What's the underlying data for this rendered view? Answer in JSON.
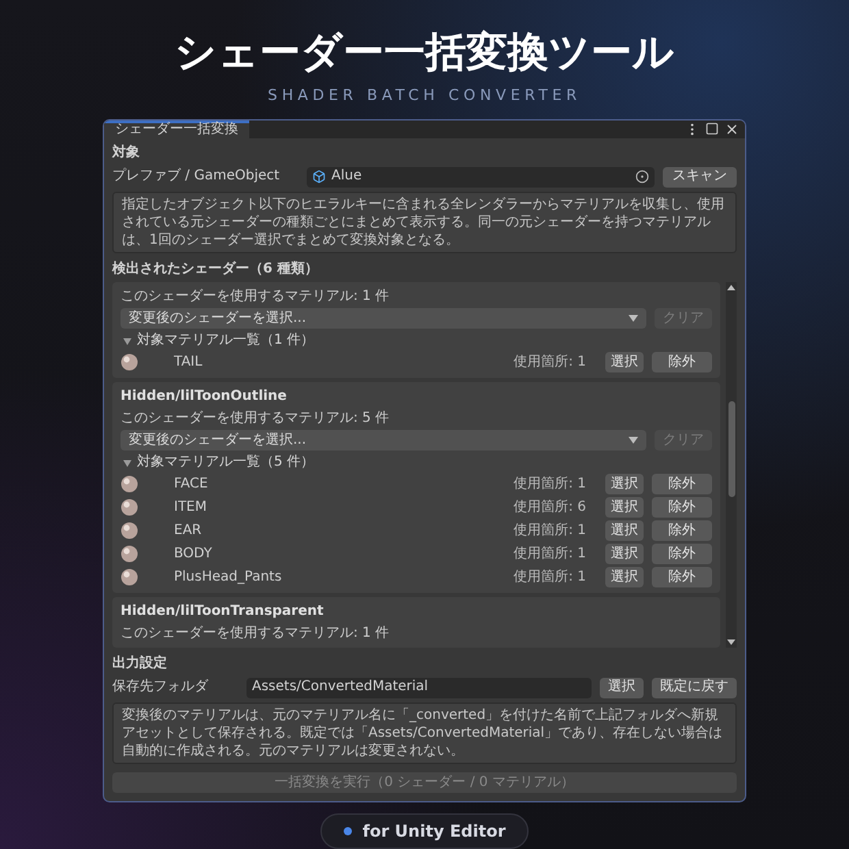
{
  "hero": {
    "title": "シェーダー一括変換ツール",
    "subtitle": "SHADER BATCH CONVERTER"
  },
  "window": {
    "tab": "シェーダー一括変換"
  },
  "target": {
    "heading": "対象",
    "field_label": "プレファブ / GameObject",
    "field_value": "Alue",
    "scan_button": "スキャン",
    "help": "指定したオブジェクト以下のヒエラルキーに含まれる全レンダラーからマテリアルを収集し、使用されている元シェーダーの種類ごとにまとめて表示する。同一の元シェーダーを持つマテリアルは、1回のシェーダー選択でまとめて変換対象となる。"
  },
  "detected": {
    "heading": "検出されたシェーダー（6 種類）",
    "groups": [
      {
        "count_text": "このシェーダーを使用するマテリアル: 1 件",
        "dropdown": "変更後のシェーダーを選択...",
        "clear_button": {
          "label": "クリア",
          "disabled": true
        },
        "list_header": "対象マテリアル一覧（1 件）",
        "expanded": true,
        "materials": [
          {
            "name": "TAIL",
            "usage": "使用箇所: 1",
            "select": "選択",
            "exclude": "除外"
          }
        ]
      },
      {
        "name": "Hidden/lilToonOutline",
        "count_text": "このシェーダーを使用するマテリアル: 5 件",
        "dropdown": "変更後のシェーダーを選択...",
        "clear_button": {
          "label": "クリア",
          "disabled": true
        },
        "list_header": "対象マテリアル一覧（5 件）",
        "expanded": true,
        "materials": [
          {
            "name": "FACE",
            "usage": "使用箇所: 1",
            "select": "選択",
            "exclude": "除外"
          },
          {
            "name": "ITEM",
            "usage": "使用箇所: 6",
            "select": "選択",
            "exclude": "除外"
          },
          {
            "name": "EAR",
            "usage": "使用箇所: 1",
            "select": "選択",
            "exclude": "除外"
          },
          {
            "name": "BODY",
            "usage": "使用箇所: 1",
            "select": "選択",
            "exclude": "除外"
          },
          {
            "name": "PlusHead_Pants",
            "usage": "使用箇所: 1",
            "select": "選択",
            "exclude": "除外"
          }
        ]
      },
      {
        "name": "Hidden/lilToonTransparent",
        "count_text": "このシェーダーを使用するマテリアル: 1 件"
      }
    ]
  },
  "output": {
    "heading": "出力設定",
    "label": "保存先フォルダ",
    "value": "Assets/ConvertedMaterial",
    "select_button": "選択",
    "reset_button": "既定に戻す",
    "help": "変換後のマテリアルは、元のマテリアル名に「_converted」を付けた名前で上記フォルダへ新規アセットとして保存される。既定では「Assets/ConvertedMaterial」であり、存在しない場合は自動的に作成される。元のマテリアルは変更されない。"
  },
  "execute_button": {
    "label": "一括変換を実行（0 シェーダー / 0 マテリアル）",
    "disabled": true
  },
  "badge": "for Unity Editor"
}
